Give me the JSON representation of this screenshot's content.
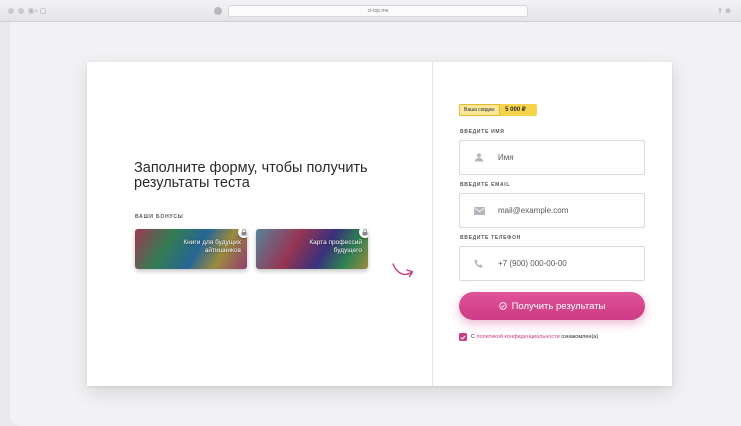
{
  "browser": {
    "url": "ct-top.me",
    "nav_glyphs": "‹ › ▢",
    "right_glyphs": "⇪ ⊕"
  },
  "form": {
    "heading": "Заполните форму, чтобы получить результаты теста",
    "bonuses_title": "ВАШИ БОНУСЫ",
    "bonuses": [
      {
        "label": "Книги для будущих айтишников"
      },
      {
        "label": "Карта профессий будущего"
      }
    ],
    "discount": {
      "label": "Ваша скидка:",
      "value": "5 000 ₽"
    },
    "name": {
      "label": "ВВЕДИТЕ ИМЯ",
      "placeholder": "Имя",
      "icon": "user-icon"
    },
    "email": {
      "label": "ВВЕДИТЕ EMAIL",
      "placeholder": "mail@example.com",
      "icon": "envelope-icon"
    },
    "phone": {
      "label": "ВВЕДИТЕ ТЕЛЕФОН",
      "placeholder": "+7 (900) 000-00-00",
      "icon": "phone-icon"
    },
    "submit_label": "Получить результаты",
    "consent": {
      "prefix": "С ",
      "link": "политикой конфиденциальности",
      "suffix": " ознакомлен(а)",
      "checked": true
    }
  },
  "colors": {
    "accent": "#cc3b85",
    "discount_badge": "#f5d34a"
  }
}
